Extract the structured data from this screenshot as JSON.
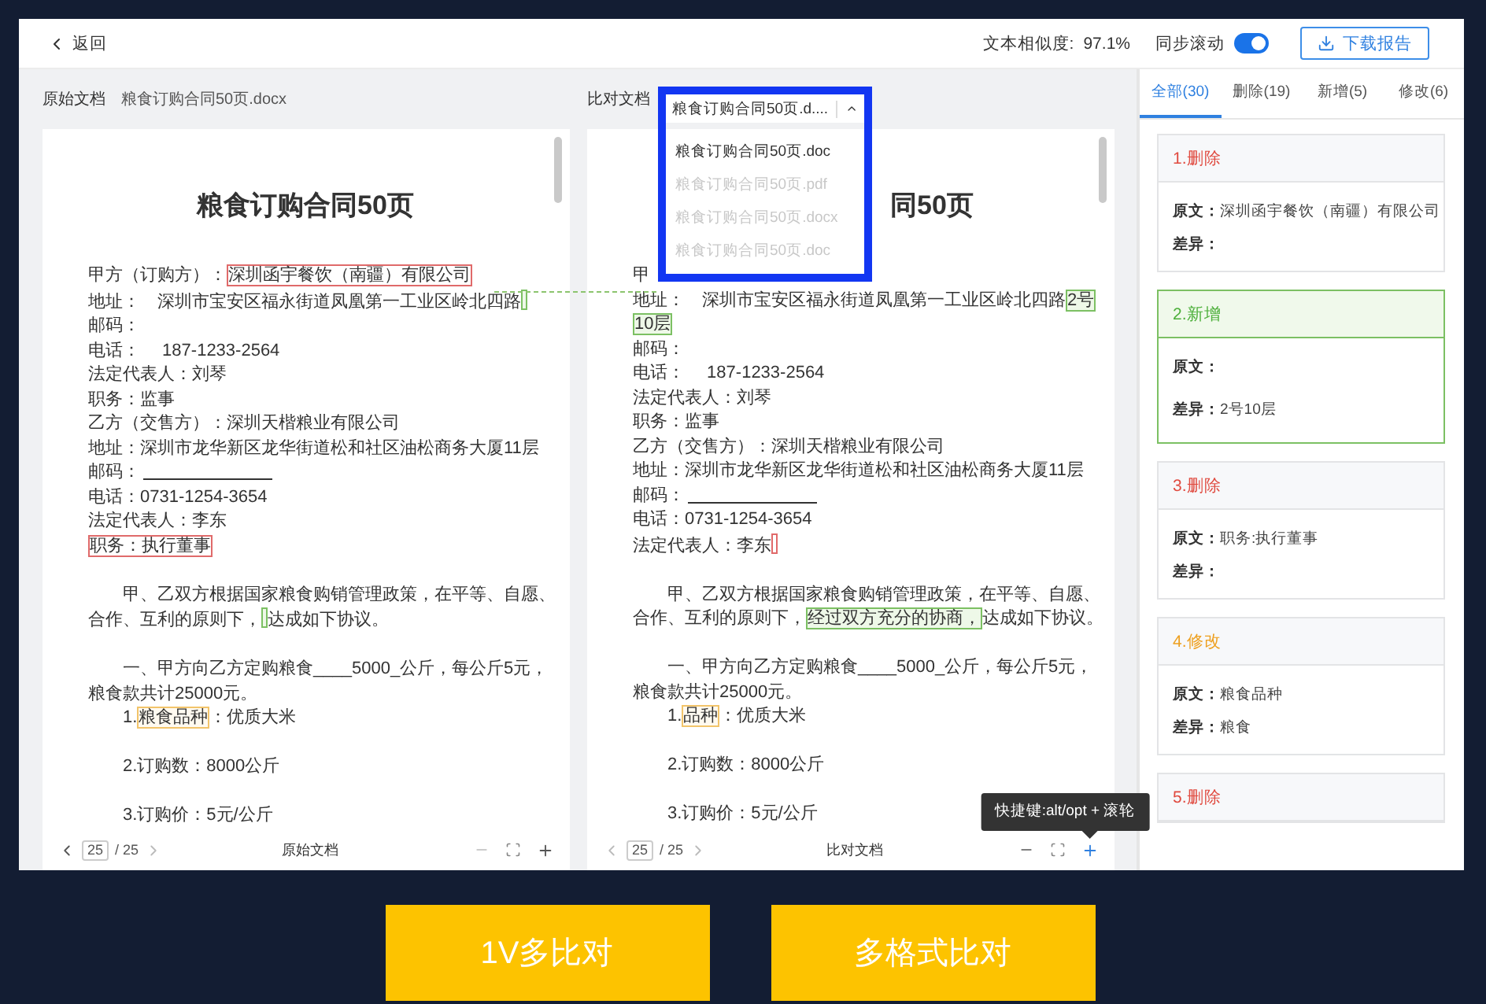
{
  "header": {
    "back": "返回",
    "similarity_label": "文本相似度:",
    "similarity": "97.1%",
    "sync_label": "同步滚动",
    "sync_on": true,
    "download": "下载报告"
  },
  "panes": [
    {
      "label": "原始文档",
      "file": "粮食订购合同50页.docx",
      "title": "粮食订购合同50页",
      "lines": [
        {
          "segments": [
            {
              "text": "甲方（订购方）："
            },
            {
              "text": "深圳函宇餐饮（南疆）有限公司",
              "kind": "delete"
            }
          ]
        },
        {
          "segments": [
            {
              "text": "地址：　深圳市宝安区福永街道凤凰第一工业区岭北四路"
            },
            {
              "kind": "add"
            }
          ]
        },
        {
          "segments": [
            {
              "text": "邮码："
            }
          ]
        },
        {
          "segments": [
            {
              "text": "电话：　 187-1233-2564"
            }
          ]
        },
        {
          "segments": [
            {
              "text": "法定代表人：刘琴"
            }
          ]
        },
        {
          "segments": [
            {
              "text": "职务：监事"
            }
          ]
        },
        {
          "segments": [
            {
              "text": "乙方（交售方）：深圳天楷粮业有限公司"
            }
          ]
        },
        {
          "segments": [
            {
              "text": "地址：深圳市龙华新区龙华街道松和社区油松商务大厦11层"
            }
          ]
        },
        {
          "segments": [
            {
              "text": "邮码："
            }
          ],
          "blank": true
        },
        {
          "segments": [
            {
              "text": "电话：0731-1254-3654"
            }
          ]
        },
        {
          "segments": [
            {
              "text": "法定代表人：李东"
            }
          ]
        },
        {
          "segments": [
            {
              "text": "职务：执行董事",
              "kind": "delete"
            }
          ]
        },
        {
          "segments": [
            {
              "text": "甲、乙双方根据国家粮食购销管理政策，在平等、自愿、"
            }
          ],
          "gap": true,
          "indent": true
        },
        {
          "segments": [
            {
              "text": "合作、互利的原则下，"
            },
            {
              "kind": "add"
            },
            {
              "text": "达成如下协议。"
            }
          ]
        },
        {
          "segments": [
            {
              "text": "一、甲方向乙方定购粮食____5000_公斤，每公斤5元，"
            }
          ],
          "gap": true,
          "indent": true
        },
        {
          "segments": [
            {
              "text": "粮食款共计25000元。"
            }
          ]
        },
        {
          "segments": [
            {
              "text": "1."
            },
            {
              "text": "粮食品种",
              "kind": "modify"
            },
            {
              "text": "：优质大米"
            }
          ],
          "indent": true
        },
        {
          "segments": [
            {
              "text": "2.订购数：8000公斤"
            }
          ],
          "gap": true,
          "indent": true
        },
        {
          "segments": [
            {
              "text": "3.订购价：5元/公斤"
            }
          ],
          "gap": true,
          "indent": true
        }
      ],
      "footer": {
        "page": "25",
        "total": "/ 25",
        "name": "原始文档",
        "zoom_in_active": false
      }
    },
    {
      "label": "比对文档",
      "dropdown": {
        "value": "粮食订购合同50页.d....",
        "expanded": true,
        "options": [
          {
            "label": "粮食订购合同50页.doc",
            "disabled": false
          },
          {
            "label": "粮食订购合同50页.pdf",
            "disabled": true
          },
          {
            "label": "粮食订购合同50页.docx",
            "disabled": true
          },
          {
            "label": "粮食订购合同50页.doc",
            "disabled": true
          }
        ]
      },
      "title": "同50页",
      "lines": [
        {
          "segments": [
            {
              "text": "甲"
            }
          ]
        },
        {
          "segments": [
            {
              "text": "地址：　深圳市宝安区福永街道凤凰第一工业区岭北四路"
            },
            {
              "text": "2号",
              "kind": "add"
            }
          ]
        },
        {
          "segments": [
            {
              "text": "10层",
              "kind": "add"
            }
          ]
        },
        {
          "segments": [
            {
              "text": "邮码："
            }
          ]
        },
        {
          "segments": [
            {
              "text": "电话：　 187-1233-2564"
            }
          ]
        },
        {
          "segments": [
            {
              "text": "法定代表人：刘琴"
            }
          ]
        },
        {
          "segments": [
            {
              "text": "职务：监事"
            }
          ]
        },
        {
          "segments": [
            {
              "text": "乙方（交售方）：深圳天楷粮业有限公司"
            }
          ]
        },
        {
          "segments": [
            {
              "text": "地址：深圳市龙华新区龙华街道松和社区油松商务大厦11层"
            }
          ]
        },
        {
          "segments": [
            {
              "text": "邮码："
            }
          ],
          "blank": true
        },
        {
          "segments": [
            {
              "text": "电话：0731-1254-3654"
            }
          ]
        },
        {
          "segments": [
            {
              "text": "法定代表人：李东"
            },
            {
              "kind": "delete"
            }
          ]
        },
        {
          "segments": [
            {
              "text": "甲、乙双方根据国家粮食购销管理政策，在平等、自愿、"
            }
          ],
          "gap": true,
          "indent": true
        },
        {
          "segments": [
            {
              "text": "合作、互利的原则下，"
            },
            {
              "text": "经过双方充分的协商，",
              "kind": "add"
            },
            {
              "text": "达成如下协议。"
            }
          ]
        },
        {
          "segments": [
            {
              "text": "一、甲方向乙方定购粮食____5000_公斤，每公斤5元，"
            }
          ],
          "gap": true,
          "indent": true
        },
        {
          "segments": [
            {
              "text": "粮食款共计25000元。"
            }
          ]
        },
        {
          "segments": [
            {
              "text": "1."
            },
            {
              "text": "品种",
              "kind": "modify"
            },
            {
              "text": "：优质大米"
            }
          ],
          "indent": true
        },
        {
          "segments": [
            {
              "text": "2.订购数：8000公斤"
            }
          ],
          "gap": true,
          "indent": true
        },
        {
          "segments": [
            {
              "text": "3.订购价：5元/公斤"
            }
          ],
          "gap": true,
          "indent": true
        }
      ],
      "footer": {
        "page": "25",
        "total": "/ 25",
        "name": "比对文档",
        "zoom_in_active": true,
        "tooltip": "快捷键:alt/opt + 滚轮"
      }
    }
  ],
  "diff_panel": {
    "tabs": [
      {
        "label": "全部(30)",
        "selected": true
      },
      {
        "label": "删除(19)",
        "selected": false
      },
      {
        "label": "新增(5)",
        "selected": false
      },
      {
        "label": "修改(6)",
        "selected": false
      }
    ],
    "cards": [
      {
        "kind": "delete",
        "title": "1.删除",
        "original_label": "原文：",
        "original": "深圳函宇餐饮（南疆）有限公司",
        "diff_label": "差异：",
        "selected": false
      },
      {
        "kind": "add",
        "title": "2.新增",
        "original_label": "原文：",
        "diff_label": "差异：",
        "diff": "2号10层",
        "selected": true
      },
      {
        "kind": "delete",
        "title": "3.删除",
        "original_label": "原文：",
        "original": "职务:执行董事",
        "diff_label": "差异：",
        "selected": false
      },
      {
        "kind": "modify",
        "title": "4.修改",
        "original_label": "原文：",
        "original": "粮食品种",
        "diff_label": "差异：",
        "diff": "粮食",
        "selected": false
      },
      {
        "kind": "delete",
        "title": "5.删除",
        "selected": false
      }
    ]
  },
  "feature_buttons": [
    "1V多比对",
    "多格式比对"
  ]
}
